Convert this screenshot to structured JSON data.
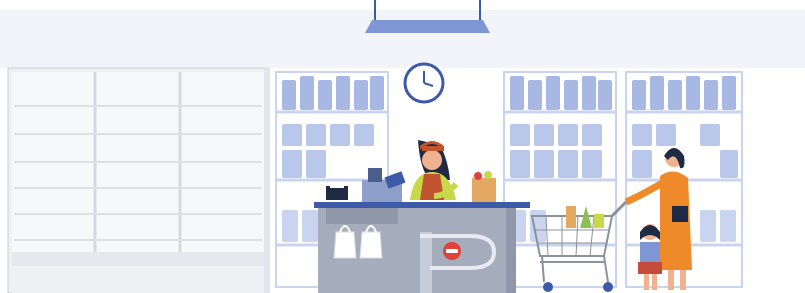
{
  "scene": {
    "colors": {
      "background_top": "#ffffff",
      "background_band": "#f2f4f9",
      "floor": "#ffffff",
      "shelf_light_blue": "#c9d4ee",
      "product_blue": "#9fb2e0",
      "product_dark_blue": "#7f96d4",
      "counter_gray": "#9ea7b8",
      "counter_top": "#3d5aa8",
      "cashier_shirt": "#c8d84a",
      "cashier_apron": "#c0542f",
      "woman_dress": "#ee8a2a",
      "child_skirt": "#c54b3a",
      "no_entry_red": "#e0413a",
      "cart_metal": "#8b929c",
      "fridge_white": "#f5f6f8"
    },
    "icons": [
      "wall-clock-icon",
      "no-entry-sign-icon",
      "shopping-bag-icon",
      "shopping-cart-icon",
      "cash-register-icon"
    ]
  }
}
